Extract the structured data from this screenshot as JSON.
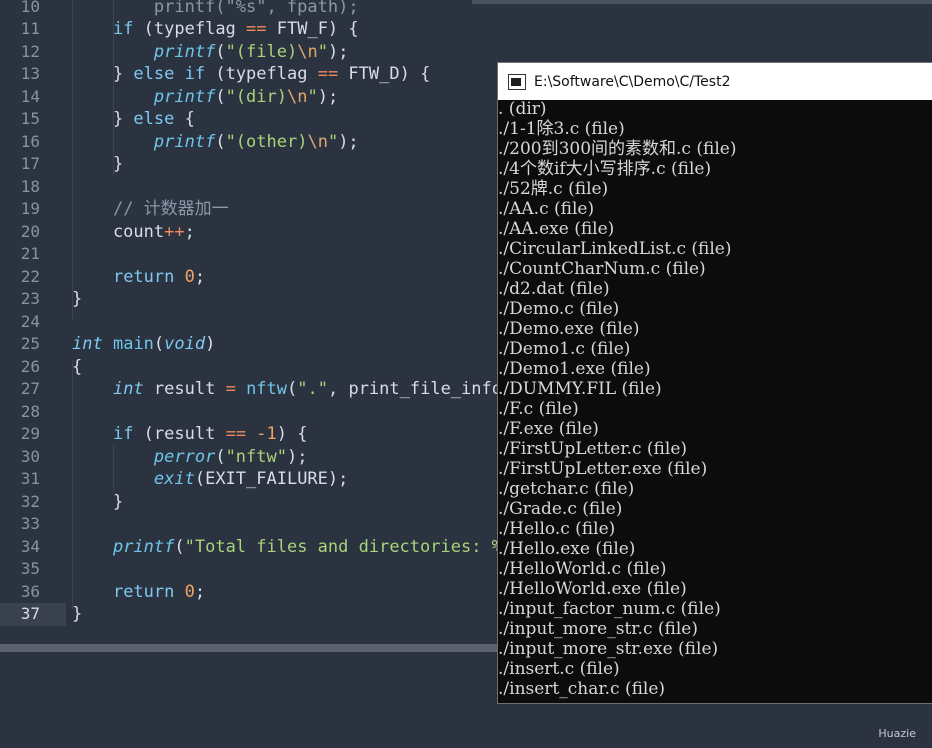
{
  "editor": {
    "lines": [
      {
        "n": "10",
        "segs": [
          {
            "t": "        printf(\"%s\", fpath);",
            "c": "cmt"
          }
        ]
      },
      {
        "n": "11",
        "segs": [
          {
            "t": "    ",
            "c": ""
          },
          {
            "t": "if",
            "c": "kw"
          },
          {
            "t": " (typeflag ",
            "c": ""
          },
          {
            "t": "==",
            "c": "op"
          },
          {
            "t": " FTW_F) {",
            "c": ""
          }
        ]
      },
      {
        "n": "12",
        "segs": [
          {
            "t": "        ",
            "c": ""
          },
          {
            "t": "printf",
            "c": "fn"
          },
          {
            "t": "(",
            "c": ""
          },
          {
            "t": "\"(file)",
            "c": "str"
          },
          {
            "t": "\\n",
            "c": "esc"
          },
          {
            "t": "\"",
            "c": "str"
          },
          {
            "t": ");",
            "c": ""
          }
        ]
      },
      {
        "n": "13",
        "segs": [
          {
            "t": "    } ",
            "c": ""
          },
          {
            "t": "else",
            "c": "kw"
          },
          {
            "t": " ",
            "c": ""
          },
          {
            "t": "if",
            "c": "kw"
          },
          {
            "t": " (typeflag ",
            "c": ""
          },
          {
            "t": "==",
            "c": "op"
          },
          {
            "t": " FTW_D) {",
            "c": ""
          }
        ]
      },
      {
        "n": "14",
        "segs": [
          {
            "t": "        ",
            "c": ""
          },
          {
            "t": "printf",
            "c": "fn"
          },
          {
            "t": "(",
            "c": ""
          },
          {
            "t": "\"(dir)",
            "c": "str"
          },
          {
            "t": "\\n",
            "c": "esc"
          },
          {
            "t": "\"",
            "c": "str"
          },
          {
            "t": ");",
            "c": ""
          }
        ]
      },
      {
        "n": "15",
        "segs": [
          {
            "t": "    } ",
            "c": ""
          },
          {
            "t": "else",
            "c": "kw"
          },
          {
            "t": " {",
            "c": ""
          }
        ]
      },
      {
        "n": "16",
        "segs": [
          {
            "t": "        ",
            "c": ""
          },
          {
            "t": "printf",
            "c": "fn"
          },
          {
            "t": "(",
            "c": ""
          },
          {
            "t": "\"(other)",
            "c": "str"
          },
          {
            "t": "\\n",
            "c": "esc"
          },
          {
            "t": "\"",
            "c": "str"
          },
          {
            "t": ");",
            "c": ""
          }
        ]
      },
      {
        "n": "17",
        "segs": [
          {
            "t": "    }",
            "c": ""
          }
        ]
      },
      {
        "n": "18",
        "segs": []
      },
      {
        "n": "19",
        "segs": [
          {
            "t": "    ",
            "c": ""
          },
          {
            "t": "// 计数器加一",
            "c": "cmt"
          }
        ]
      },
      {
        "n": "20",
        "segs": [
          {
            "t": "    count",
            "c": ""
          },
          {
            "t": "++",
            "c": "op"
          },
          {
            "t": ";",
            "c": ""
          }
        ]
      },
      {
        "n": "21",
        "segs": []
      },
      {
        "n": "22",
        "segs": [
          {
            "t": "    ",
            "c": ""
          },
          {
            "t": "return",
            "c": "kw"
          },
          {
            "t": " ",
            "c": ""
          },
          {
            "t": "0",
            "c": "num"
          },
          {
            "t": ";",
            "c": ""
          }
        ]
      },
      {
        "n": "23",
        "segs": [
          {
            "t": "}",
            "c": ""
          }
        ]
      },
      {
        "n": "24",
        "segs": []
      },
      {
        "n": "25",
        "segs": [
          {
            "t": "int",
            "c": "kwi"
          },
          {
            "t": " ",
            "c": ""
          },
          {
            "t": "main",
            "c": "fnn"
          },
          {
            "t": "(",
            "c": ""
          },
          {
            "t": "void",
            "c": "kwi"
          },
          {
            "t": ")",
            "c": ""
          }
        ]
      },
      {
        "n": "26",
        "segs": [
          {
            "t": "{",
            "c": ""
          }
        ]
      },
      {
        "n": "27",
        "segs": [
          {
            "t": "    ",
            "c": ""
          },
          {
            "t": "int",
            "c": "kwi"
          },
          {
            "t": " result ",
            "c": ""
          },
          {
            "t": "=",
            "c": "op"
          },
          {
            "t": " ",
            "c": ""
          },
          {
            "t": "nftw",
            "c": "fnn"
          },
          {
            "t": "(",
            "c": ""
          },
          {
            "t": "\".\"",
            "c": "str"
          },
          {
            "t": ", print_file_info",
            "c": ""
          }
        ]
      },
      {
        "n": "28",
        "segs": []
      },
      {
        "n": "29",
        "segs": [
          {
            "t": "    ",
            "c": ""
          },
          {
            "t": "if",
            "c": "kw"
          },
          {
            "t": " (result ",
            "c": ""
          },
          {
            "t": "==",
            "c": "op"
          },
          {
            "t": " ",
            "c": ""
          },
          {
            "t": "-1",
            "c": "num"
          },
          {
            "t": ") {",
            "c": ""
          }
        ]
      },
      {
        "n": "30",
        "segs": [
          {
            "t": "        ",
            "c": ""
          },
          {
            "t": "perror",
            "c": "fn"
          },
          {
            "t": "(",
            "c": ""
          },
          {
            "t": "\"nftw\"",
            "c": "str"
          },
          {
            "t": ");",
            "c": ""
          }
        ]
      },
      {
        "n": "31",
        "segs": [
          {
            "t": "        ",
            "c": ""
          },
          {
            "t": "exit",
            "c": "fn"
          },
          {
            "t": "(EXIT_FAILURE);",
            "c": ""
          }
        ]
      },
      {
        "n": "32",
        "segs": [
          {
            "t": "    }",
            "c": ""
          }
        ]
      },
      {
        "n": "33",
        "segs": []
      },
      {
        "n": "34",
        "segs": [
          {
            "t": "    ",
            "c": ""
          },
          {
            "t": "printf",
            "c": "fn"
          },
          {
            "t": "(",
            "c": ""
          },
          {
            "t": "\"Total files and directories: %",
            "c": "str"
          }
        ]
      },
      {
        "n": "35",
        "segs": []
      },
      {
        "n": "36",
        "segs": [
          {
            "t": "    ",
            "c": ""
          },
          {
            "t": "return",
            "c": "kw"
          },
          {
            "t": " ",
            "c": ""
          },
          {
            "t": "0",
            "c": "num"
          },
          {
            "t": ";",
            "c": ""
          }
        ]
      },
      {
        "n": "37",
        "segs": [
          {
            "t": "}",
            "c": ""
          }
        ],
        "current": true
      }
    ]
  },
  "console": {
    "title": "E:\\Software\\C\\Demo\\C/Test2",
    "lines": [
      ". (dir)",
      "./1-1除3.c (file)",
      "./200到300间的素数和.c (file)",
      "./4个数if大小写排序.c (file)",
      "./52牌.c (file)",
      "./AA.c (file)",
      "./AA.exe (file)",
      "./CircularLinkedList.c (file)",
      "./CountCharNum.c (file)",
      "./d2.dat (file)",
      "./Demo.c (file)",
      "./Demo.exe (file)",
      "./Demo1.c (file)",
      "./Demo1.exe (file)",
      "./DUMMY.FIL (file)",
      "./F.c (file)",
      "./F.exe (file)",
      "./FirstUpLetter.c (file)",
      "./FirstUpLetter.exe (file)",
      "./getchar.c (file)",
      "./Grade.c (file)",
      "./Hello.c (file)",
      "./Hello.exe (file)",
      "./HelloWorld.c (file)",
      "./HelloWorld.exe (file)",
      "./input_factor_num.c (file)",
      "./input_more_str.c (file)",
      "./input_more_str.exe (file)",
      "./insert.c (file)",
      "./insert_char.c (file)"
    ]
  },
  "watermark": "Huazie"
}
